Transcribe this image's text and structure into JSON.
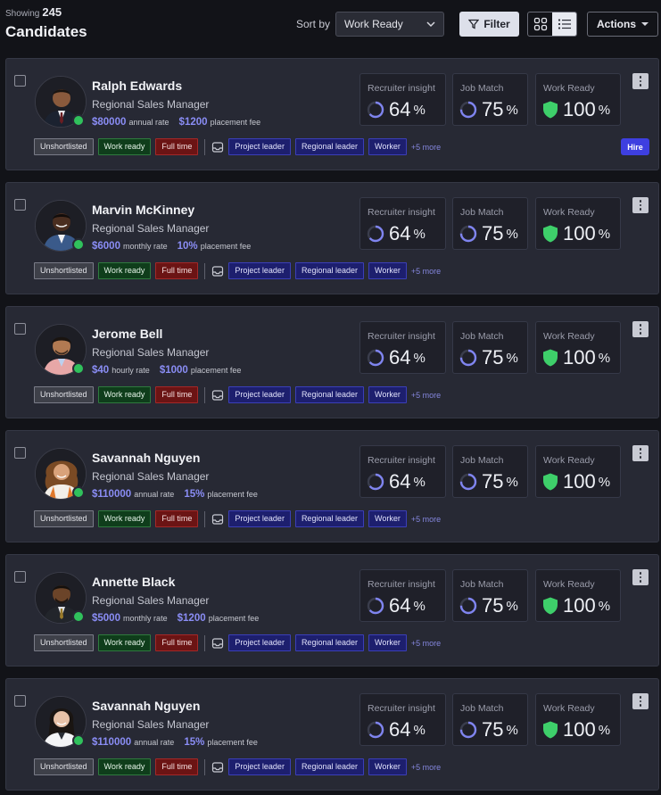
{
  "header": {
    "showing_label": "Showing",
    "showing_count": "245",
    "title": "Candidates",
    "sort_label": "Sort by",
    "sort_value": "Work Ready",
    "filter_label": "Filter",
    "actions_label": "Actions"
  },
  "tag_labels": {
    "unshortlisted": "Unshortlisted",
    "work_ready": "Work ready",
    "full_time": "Full time",
    "skills": [
      "Project leader",
      "Regional leader",
      "Worker"
    ],
    "more": "+5 more"
  },
  "metric_labels": {
    "insight": "Recruiter insight",
    "match": "Job Match",
    "ready": "Work Ready"
  },
  "hire_label": "Hire",
  "colors": {
    "accent": "#8a8df5",
    "online": "#30c15c",
    "hire": "#3e3fe0"
  },
  "candidates": [
    {
      "name": "Ralph Edwards",
      "role": "Regional Sales Manager",
      "rate": "$80000",
      "rate_unit": "annual rate",
      "fee": "$1200",
      "fee_unit": "placement fee",
      "insight": "64",
      "match": "75",
      "ready": "100",
      "shows_hire": true,
      "avatar": "male-suit"
    },
    {
      "name": "Marvin McKinney",
      "role": "Regional Sales Manager",
      "rate": "$6000",
      "rate_unit": "monthly rate",
      "fee": "10%",
      "fee_unit": "placement fee",
      "insight": "64",
      "match": "75",
      "ready": "100",
      "shows_hire": false,
      "avatar": "male-blue"
    },
    {
      "name": "Jerome Bell",
      "role": "Regional Sales Manager",
      "rate": "$40",
      "rate_unit": "hourly rate",
      "fee": "$1000",
      "fee_unit": "placement fee",
      "insight": "64",
      "match": "75",
      "ready": "100",
      "shows_hire": false,
      "avatar": "male-pink"
    },
    {
      "name": "Savannah Nguyen",
      "role": "Regional Sales Manager",
      "rate": "$110000",
      "rate_unit": "annual rate",
      "fee": "15%",
      "fee_unit": "placement fee",
      "insight": "64",
      "match": "75",
      "ready": "100",
      "shows_hire": false,
      "avatar": "female-curly"
    },
    {
      "name": "Annette Black",
      "role": "Regional Sales Manager",
      "rate": "$5000",
      "rate_unit": "monthly rate",
      "fee": "$1200",
      "fee_unit": "placement fee",
      "insight": "64",
      "match": "75",
      "ready": "100",
      "shows_hire": false,
      "avatar": "male-dark-suit"
    },
    {
      "name": "Savannah Nguyen",
      "role": "Regional Sales Manager",
      "rate": "$110000",
      "rate_unit": "annual rate",
      "fee": "15%",
      "fee_unit": "placement fee",
      "insight": "64",
      "match": "75",
      "ready": "100",
      "shows_hire": false,
      "avatar": "female-dark"
    }
  ]
}
